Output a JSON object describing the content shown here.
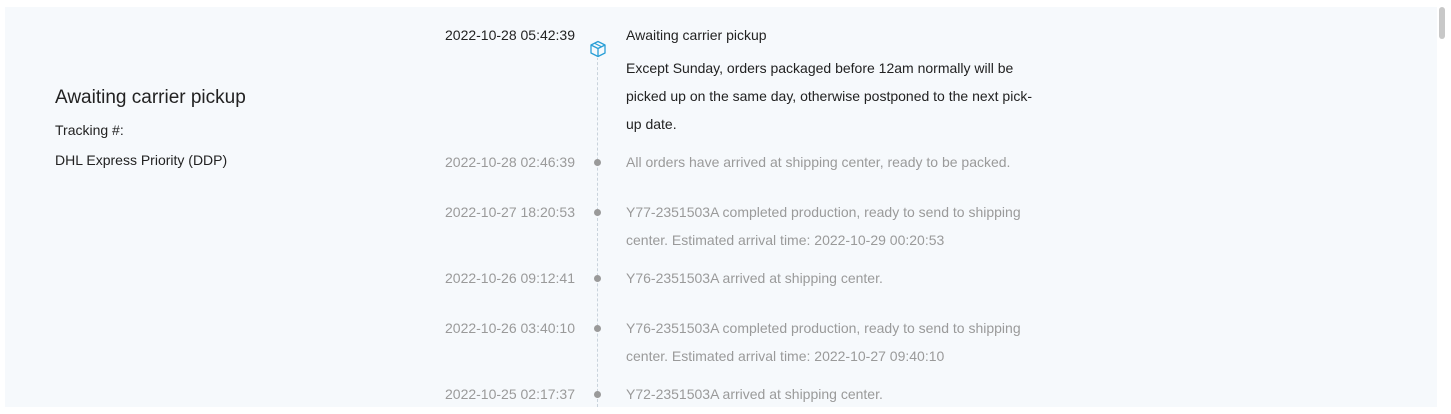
{
  "summary": {
    "status": "Awaiting carrier pickup",
    "tracking_label": "Tracking #:",
    "carrier": "DHL Express Priority (DDP)"
  },
  "events": [
    {
      "time": "2022-10-28 05:42:39",
      "title": "Awaiting carrier pickup",
      "note": "Except Sunday, orders packaged before 12am normally will be picked up on the same day, otherwise postponed to the next pick-up date.",
      "icon": "package-icon"
    },
    {
      "time": "2022-10-28 02:46:39",
      "title": "All orders have arrived at shipping center, ready to be packed."
    },
    {
      "time": "2022-10-27 18:20:53",
      "title": "Y77-2351503A completed production, ready to send to shipping center. Estimated arrival time: 2022-10-29 00:20:53"
    },
    {
      "time": "2022-10-26 09:12:41",
      "title": "Y76-2351503A arrived at shipping center."
    },
    {
      "time": "2022-10-26 03:40:10",
      "title": "Y76-2351503A completed production, ready to send to shipping center. Estimated arrival time: 2022-10-27 09:40:10"
    },
    {
      "time": "2022-10-25 02:17:37",
      "title": "Y72-2351503A arrived at shipping center."
    }
  ],
  "colors": {
    "accent": "#2a9fd6",
    "muted": "#9a9a9a",
    "text": "#222222",
    "panel_bg": "#f6f9fc"
  }
}
